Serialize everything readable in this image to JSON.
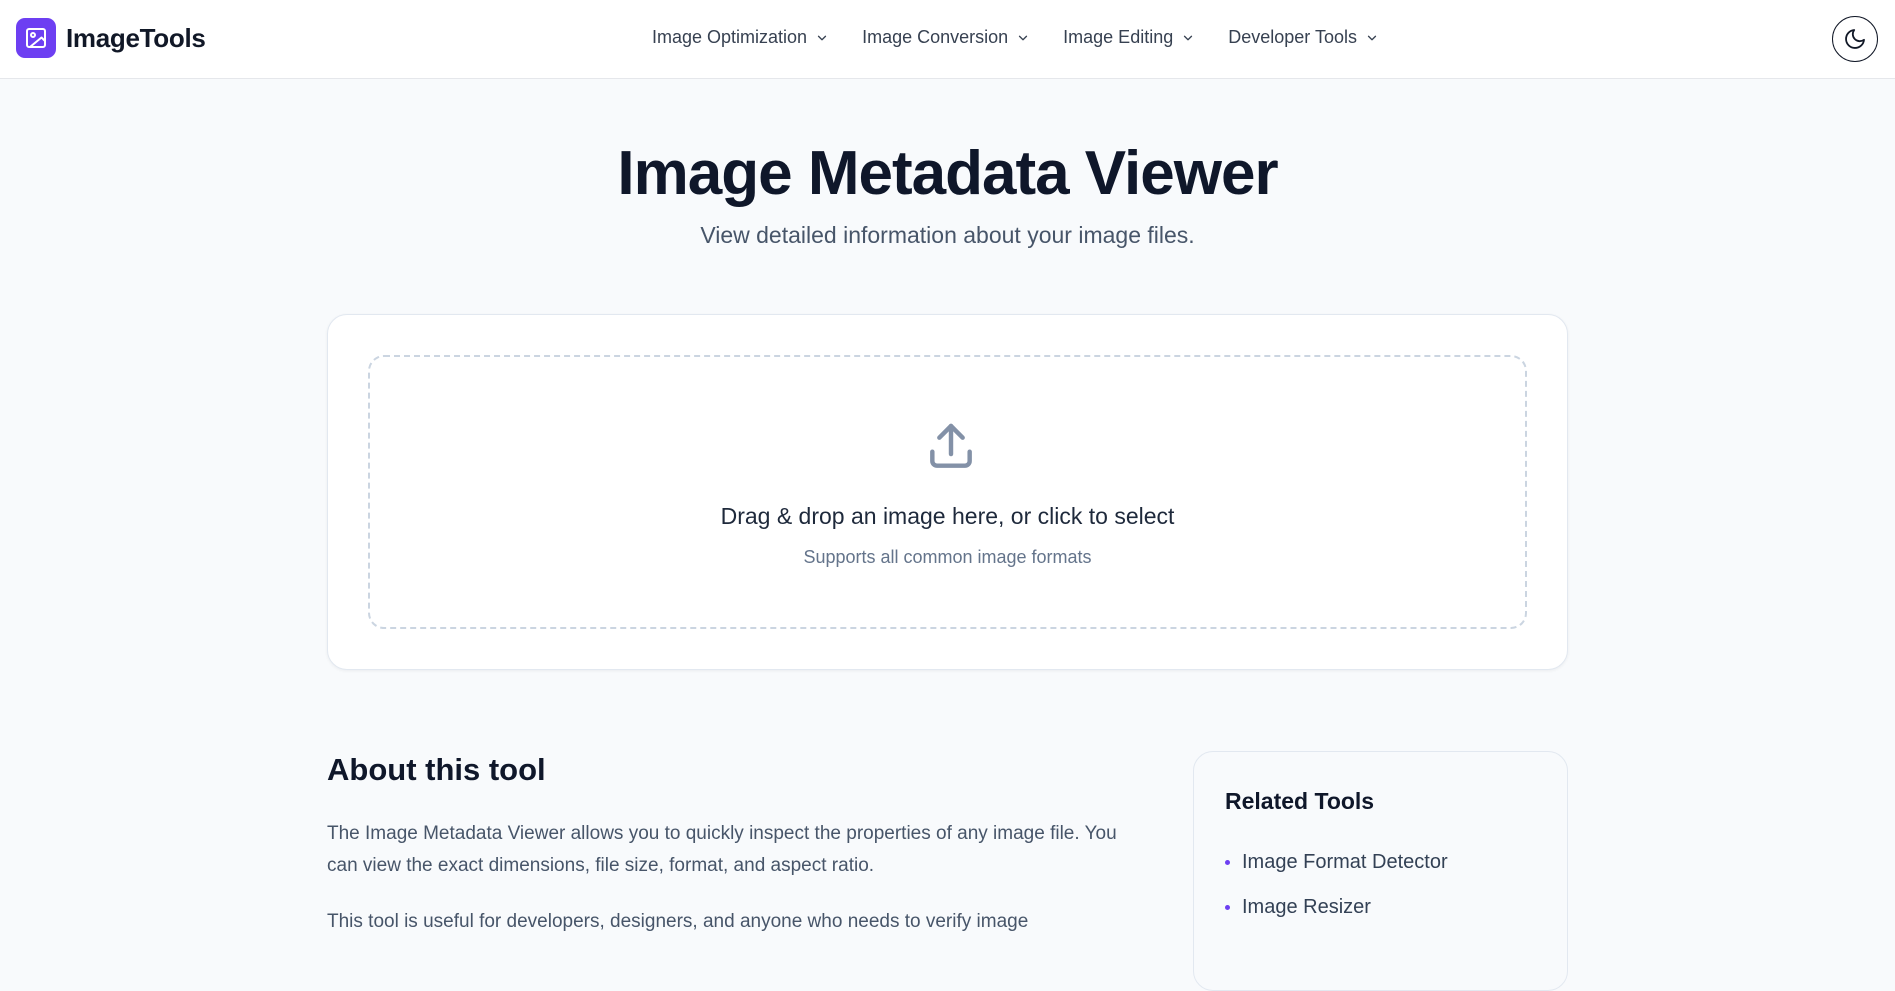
{
  "header": {
    "brand": "ImageTools",
    "nav": [
      {
        "label": "Image Optimization"
      },
      {
        "label": "Image Conversion"
      },
      {
        "label": "Image Editing"
      },
      {
        "label": "Developer Tools"
      }
    ]
  },
  "hero": {
    "title": "Image Metadata Viewer",
    "subtitle": "View detailed information about your image files."
  },
  "upload": {
    "title": "Drag & drop an image here, or click to select",
    "subtitle": "Supports all common image formats"
  },
  "about": {
    "heading": "About this tool",
    "paragraph1": "The Image Metadata Viewer allows you to quickly inspect the properties of any image file. You can view the exact dimensions, file size, format, and aspect ratio.",
    "paragraph2": "This tool is useful for developers, designers, and anyone who needs to verify image"
  },
  "related": {
    "heading": "Related Tools",
    "items": [
      {
        "label": "Image Format Detector"
      },
      {
        "label": "Image Resizer"
      }
    ]
  },
  "colors": {
    "accent": "#6d3ff2",
    "background": "#f8fafc"
  },
  "icons": {
    "brand": "image-icon",
    "nav_dropdown": "chevron-down-icon",
    "theme": "moon-icon",
    "upload": "upload-icon"
  }
}
